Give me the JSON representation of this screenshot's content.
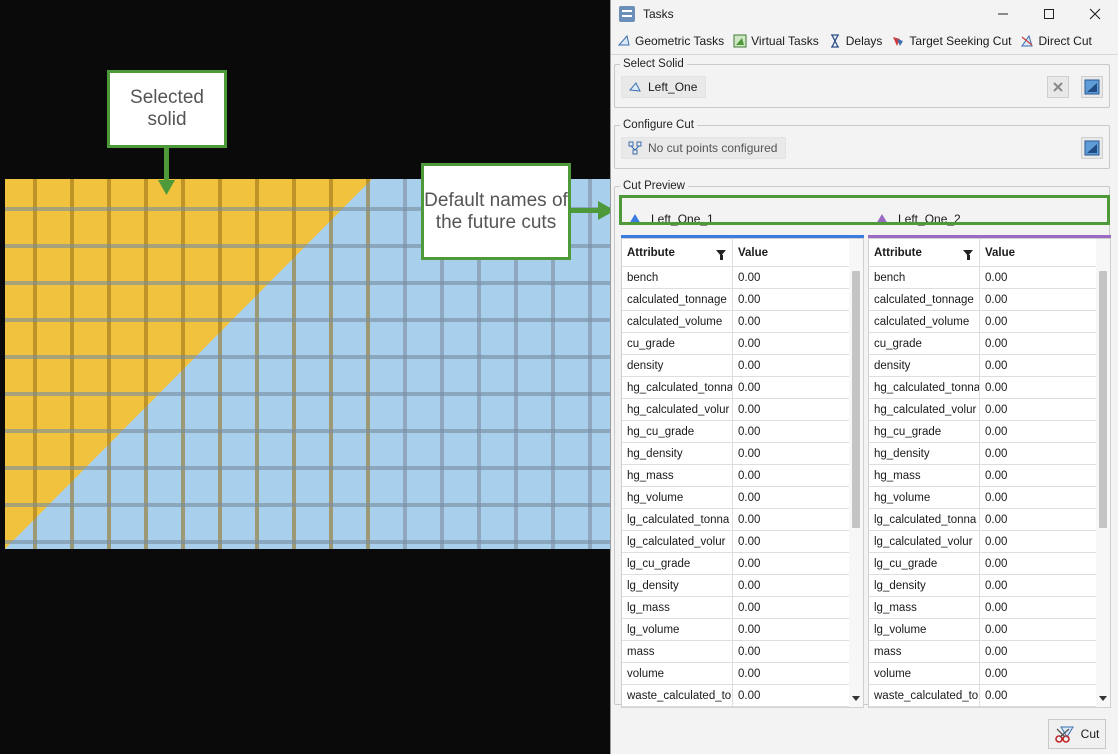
{
  "callouts": {
    "selected_solid": "Selected solid",
    "default_names": "Default names of the future cuts"
  },
  "colors": {
    "solid_yellow": "#f0c23e",
    "solid_blue": "#a8cfec",
    "callout_green": "#4e9a3a",
    "pane1_accent": "#3c7be0",
    "pane2_accent": "#9b6bc4"
  },
  "window": {
    "title": "Tasks",
    "icon": "tasks-list-icon",
    "controls": [
      "minimize-icon",
      "maximize-icon",
      "close-icon"
    ]
  },
  "tabs": [
    {
      "label": "Geometric Tasks",
      "icon": "geometric-tasks-icon"
    },
    {
      "label": "Virtual Tasks",
      "icon": "virtual-tasks-icon"
    },
    {
      "label": "Delays",
      "icon": "hourglass-icon"
    },
    {
      "label": "Target Seeking Cut",
      "icon": "target-seeking-icon"
    },
    {
      "label": "Direct Cut",
      "icon": "direct-cut-icon"
    }
  ],
  "select_solid": {
    "legend": "Select Solid",
    "value": "Left_One"
  },
  "configure_cut": {
    "legend": "Configure Cut",
    "value": "No cut points configured"
  },
  "cut_preview": {
    "legend": "Cut Preview",
    "attribute_header": "Attribute",
    "value_header": "Value",
    "panes": [
      {
        "name": "Left_One_1"
      },
      {
        "name": "Left_One_2"
      }
    ],
    "rows": [
      {
        "attribute": "bench",
        "value": "0.00"
      },
      {
        "attribute": "calculated_tonnage",
        "value": "0.00"
      },
      {
        "attribute": "calculated_volume",
        "value": "0.00"
      },
      {
        "attribute": "cu_grade",
        "value": "0.00"
      },
      {
        "attribute": "density",
        "value": "0.00"
      },
      {
        "attribute": "hg_calculated_tonna",
        "value": "0.00"
      },
      {
        "attribute": "hg_calculated_volur",
        "value": "0.00"
      },
      {
        "attribute": "hg_cu_grade",
        "value": "0.00"
      },
      {
        "attribute": "hg_density",
        "value": "0.00"
      },
      {
        "attribute": "hg_mass",
        "value": "0.00"
      },
      {
        "attribute": "hg_volume",
        "value": "0.00"
      },
      {
        "attribute": "lg_calculated_tonna",
        "value": "0.00"
      },
      {
        "attribute": "lg_calculated_volur",
        "value": "0.00"
      },
      {
        "attribute": "lg_cu_grade",
        "value": "0.00"
      },
      {
        "attribute": "lg_density",
        "value": "0.00"
      },
      {
        "attribute": "lg_mass",
        "value": "0.00"
      },
      {
        "attribute": "lg_volume",
        "value": "0.00"
      },
      {
        "attribute": "mass",
        "value": "0.00"
      },
      {
        "attribute": "volume",
        "value": "0.00"
      },
      {
        "attribute": "waste_calculated_to",
        "value": "0.00"
      }
    ]
  },
  "footer": {
    "cut_label": "Cut"
  }
}
